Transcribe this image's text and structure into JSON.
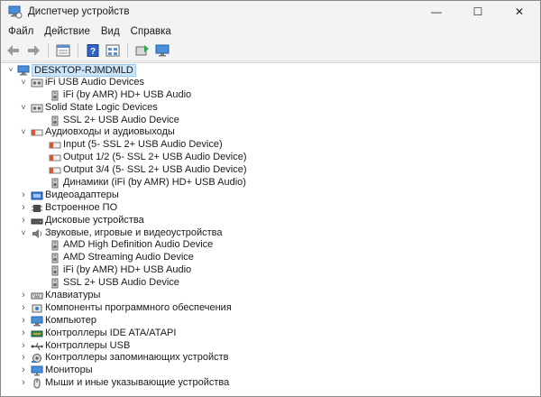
{
  "window": {
    "title": "Диспетчер устройств",
    "controls": {
      "minimize": "—",
      "maximize": "☐",
      "close": "✕"
    }
  },
  "menu": [
    "Файл",
    "Действие",
    "Вид",
    "Справка"
  ],
  "toolbar": {
    "buttons": [
      "back-icon",
      "forward-icon",
      "properties-sheet-icon",
      "help-icon",
      "view-icon",
      "update-driver-icon",
      "scan-monitor-icon"
    ]
  },
  "tree": {
    "root": "DESKTOP-RJMDMLD",
    "rows": [
      {
        "depth": 1,
        "expanded": true,
        "icon": "audio-device-icon",
        "label": "iFi USB Audio Devices"
      },
      {
        "depth": 2,
        "icon": "speaker-icon",
        "label": "iFi (by AMR) HD+ USB Audio"
      },
      {
        "depth": 1,
        "expanded": true,
        "icon": "audio-device-icon",
        "label": "Solid State Logic Devices"
      },
      {
        "depth": 2,
        "icon": "speaker-icon",
        "label": "SSL 2+ USB Audio Device"
      },
      {
        "depth": 1,
        "expanded": true,
        "icon": "audio-io-icon",
        "label": "Аудиовходы и аудиовыходы"
      },
      {
        "depth": 2,
        "icon": "audio-io-icon",
        "label": "Input (5- SSL 2+ USB Audio Device)"
      },
      {
        "depth": 2,
        "icon": "audio-io-icon",
        "label": "Output 1/2 (5- SSL 2+ USB Audio Device)"
      },
      {
        "depth": 2,
        "icon": "audio-io-icon",
        "label": "Output 3/4 (5- SSL 2+ USB Audio Device)"
      },
      {
        "depth": 2,
        "icon": "speaker-icon",
        "label": "Динамики (iFi (by AMR) HD+ USB Audio)"
      },
      {
        "depth": 1,
        "expanded": false,
        "icon": "display-adapter-icon",
        "label": "Видеоадаптеры"
      },
      {
        "depth": 1,
        "expanded": false,
        "icon": "firmware-icon",
        "label": "Встроенное ПО"
      },
      {
        "depth": 1,
        "expanded": false,
        "icon": "disk-icon",
        "label": "Дисковые устройства"
      },
      {
        "depth": 1,
        "expanded": true,
        "icon": "sound-icon",
        "label": "Звуковые, игровые и видеоустройства"
      },
      {
        "depth": 2,
        "icon": "speaker-icon",
        "label": "AMD High Definition Audio Device"
      },
      {
        "depth": 2,
        "icon": "speaker-icon",
        "label": "AMD Streaming Audio Device"
      },
      {
        "depth": 2,
        "icon": "speaker-icon",
        "label": "iFi (by AMR) HD+ USB Audio"
      },
      {
        "depth": 2,
        "icon": "speaker-icon",
        "label": "SSL 2+ USB Audio Device"
      },
      {
        "depth": 1,
        "expanded": false,
        "icon": "keyboard-icon",
        "label": "Клавиатуры"
      },
      {
        "depth": 1,
        "expanded": false,
        "icon": "software-component-icon",
        "label": "Компоненты программного обеспечения"
      },
      {
        "depth": 1,
        "expanded": false,
        "icon": "computer-icon",
        "label": "Компьютер"
      },
      {
        "depth": 1,
        "expanded": false,
        "icon": "ide-controller-icon",
        "label": "Контроллеры IDE ATA/ATAPI"
      },
      {
        "depth": 1,
        "expanded": false,
        "icon": "usb-icon",
        "label": "Контроллеры USB"
      },
      {
        "depth": 1,
        "expanded": false,
        "icon": "storage-controller-icon",
        "label": "Контроллеры запоминающих устройств"
      },
      {
        "depth": 1,
        "expanded": false,
        "icon": "monitor-icon",
        "label": "Мониторы"
      },
      {
        "depth": 1,
        "expanded": false,
        "icon": "mouse-icon",
        "label": "Мыши и иные указывающие устройства"
      }
    ]
  }
}
